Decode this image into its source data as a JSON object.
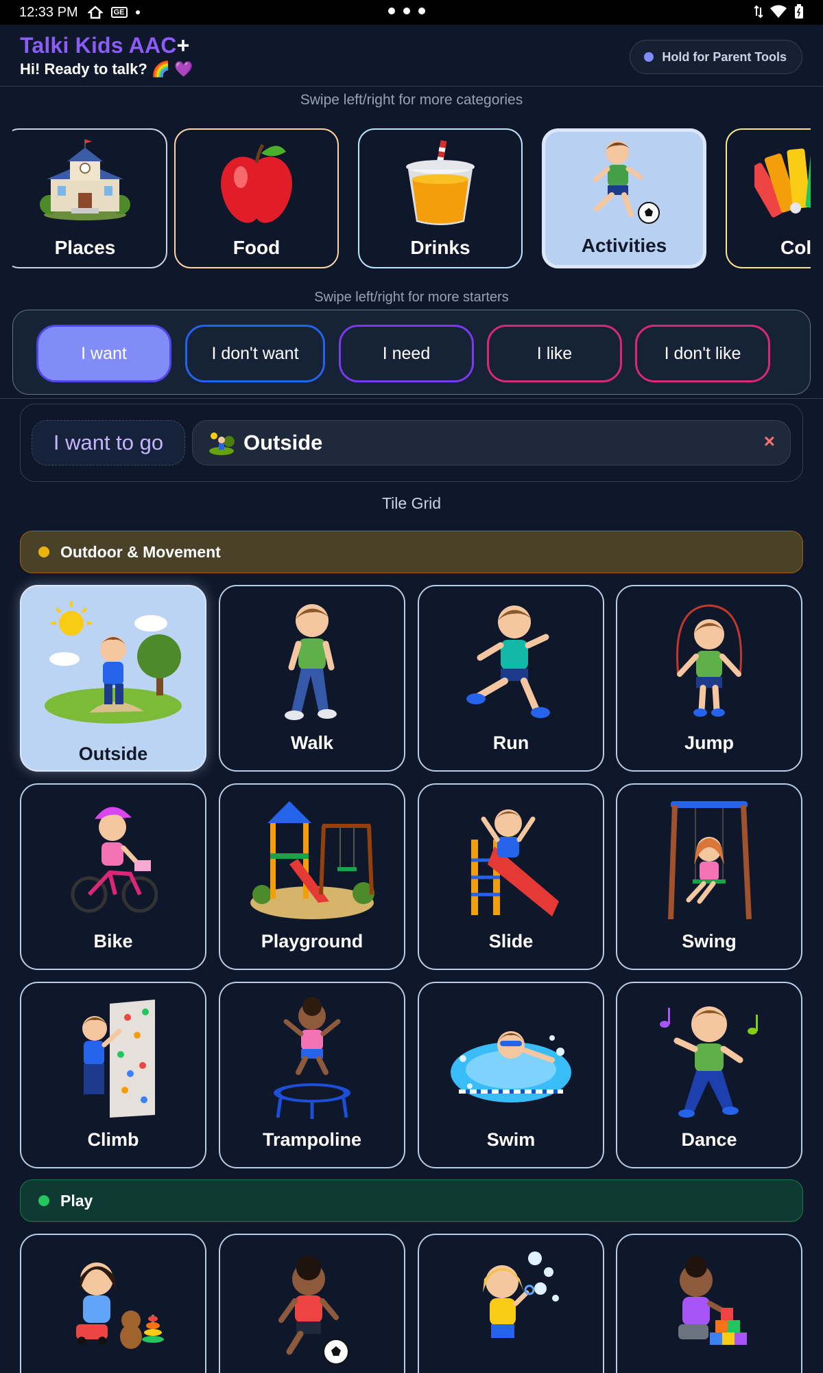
{
  "status_bar": {
    "time": "12:33 PM",
    "ge_label": "GE"
  },
  "header": {
    "title": "Talki Kids AAC",
    "title_plus": "+",
    "greeting": "Hi! Ready to talk? 🌈 💜",
    "parent_button": "Hold for Parent Tools"
  },
  "categories": {
    "hint": "Swipe left/right for more categories",
    "items": [
      {
        "label": "Places",
        "icon": "school-building-icon"
      },
      {
        "label": "Food",
        "icon": "apple-icon"
      },
      {
        "label": "Drinks",
        "icon": "juice-cup-icon"
      },
      {
        "label": "Activities",
        "icon": "soccer-kid-icon",
        "active": true
      },
      {
        "label": "Col",
        "icon": "color-swatch-icon"
      }
    ]
  },
  "starters": {
    "hint": "Swipe left/right for more starters",
    "items": [
      {
        "label": "I want",
        "active": true,
        "color": "#4f46e5"
      },
      {
        "label": "I don't want",
        "color": "#2563eb"
      },
      {
        "label": "I need",
        "color": "#7c3aed"
      },
      {
        "label": "I like",
        "color": "#db2777"
      },
      {
        "label": "I don't like",
        "color": "#db2777"
      }
    ]
  },
  "sentence": {
    "starter": "I want to go",
    "word": "Outside",
    "word_icon": "outside-icon",
    "clear": "×"
  },
  "grid": {
    "title": "Tile Grid",
    "groups": [
      {
        "name": "Outdoor & Movement",
        "color": "#eab308",
        "tiles": [
          "Outside",
          "Walk",
          "Run",
          "Jump",
          "Bike",
          "Playground",
          "Slide",
          "Swing",
          "Climb",
          "Trampoline",
          "Swim",
          "Dance"
        ],
        "selected": "Outside"
      },
      {
        "name": "Play",
        "color": "#22c55e",
        "tiles": [
          "",
          "",
          "",
          ""
        ]
      }
    ]
  }
}
